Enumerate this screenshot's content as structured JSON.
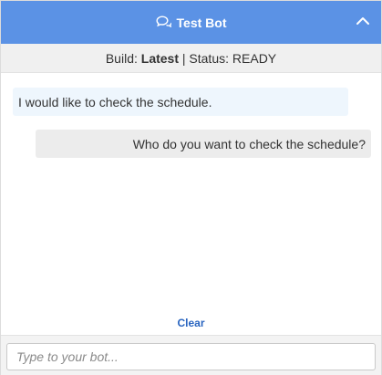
{
  "header": {
    "title": "Test Bot",
    "chat_icon": "chat-bubbles-icon",
    "collapse_icon": "chevron-up-icon"
  },
  "status": {
    "build_label": "Build:",
    "build_value": "Latest",
    "separator": "|",
    "status_label": "Status:",
    "status_value": "READY"
  },
  "messages": [
    {
      "from": "user",
      "text": "I would like to check the schedule."
    },
    {
      "from": "bot",
      "text": "Who do you want to check the schedule?"
    }
  ],
  "clear_label": "Clear",
  "composer": {
    "placeholder": "Type to your bot..."
  },
  "colors": {
    "header_bg": "#5b92e5",
    "user_bubble": "#eef6fd",
    "bot_bubble": "#ececec",
    "link": "#2a65c0"
  }
}
